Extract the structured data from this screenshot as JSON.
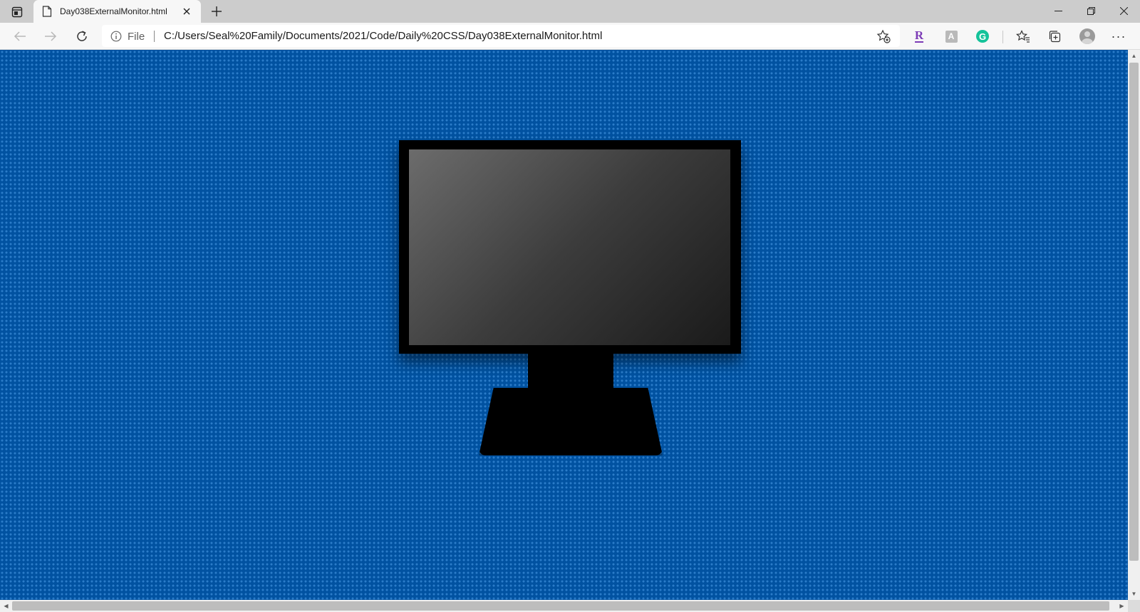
{
  "browser": {
    "tab": {
      "title": "Day038ExternalMonitor.html"
    },
    "address_bar": {
      "scheme_label": "File",
      "url": "C:/Users/Seal%20Family/Documents/2021/Code/Daily%20CSS/Day038ExternalMonitor.html"
    },
    "extensions": {
      "r_label": "R",
      "gray_label": "A",
      "grammarly_label": "G"
    },
    "menu_label": "···"
  },
  "page": {
    "background_color": "#0152a1",
    "dot_color": "#2b7cc9",
    "monitor_color": "#000000"
  }
}
